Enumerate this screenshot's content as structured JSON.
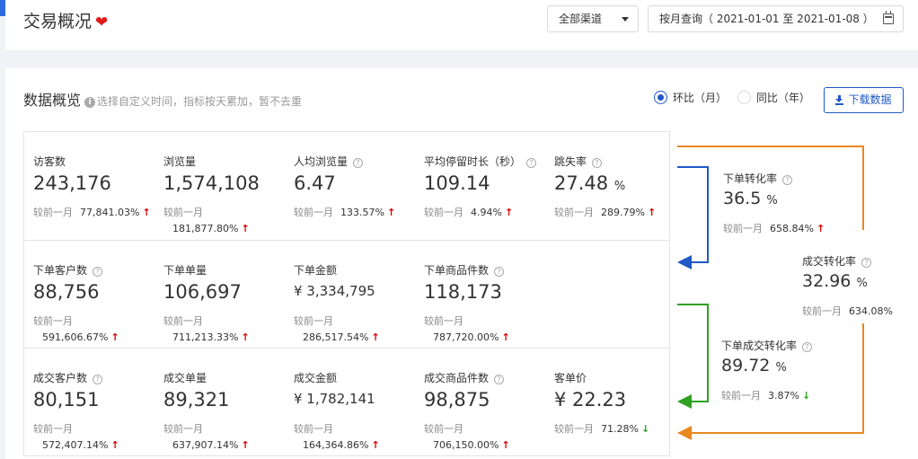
{
  "header": {
    "title": "交易概况",
    "channel": "全部渠道",
    "date_range": "按月查询（ 2021-01-01 至 2021-01-08 ）"
  },
  "overview": {
    "title": "数据概览",
    "hint": "选择自定义时间，指标按天累加，暂不去重",
    "radio_mom": "环比（月）",
    "radio_yoy": "同比（年）",
    "selected_compare": "环比（月）",
    "download_label": "下载数据"
  },
  "compare_label": "较前一月",
  "metrics_rows": [
    [
      {
        "label": "访客数",
        "help": false,
        "value": "243,176",
        "unit": "",
        "change": "77,841.03%",
        "trend": "up",
        "wrap": false
      },
      {
        "label": "浏览量",
        "help": false,
        "value": "1,574,108",
        "unit": "",
        "change": "181,877.80%",
        "trend": "up",
        "wrap": true
      },
      {
        "label": "人均浏览量",
        "help": true,
        "value": "6.47",
        "unit": "",
        "change": "133.57%",
        "trend": "up",
        "wrap": false
      },
      {
        "label": "平均停留时长（秒）",
        "help": true,
        "value": "109.14",
        "unit": "",
        "change": "4.94%",
        "trend": "up",
        "wrap": false
      },
      {
        "label": "跳失率",
        "help": true,
        "value": "27.48",
        "unit": "%",
        "change": "289.79%",
        "trend": "up",
        "wrap": false
      }
    ],
    [
      {
        "label": "下单客户数",
        "help": true,
        "value": "88,756",
        "unit": "",
        "change": "591,606.67%",
        "trend": "up",
        "wrap": true
      },
      {
        "label": "下单单量",
        "help": false,
        "value": "106,697",
        "unit": "",
        "change": "711,213.33%",
        "trend": "up",
        "wrap": true
      },
      {
        "label": "下单金额",
        "help": false,
        "value": "¥ 3,334,795",
        "unit": "",
        "change": "286,517.54%",
        "trend": "up",
        "wrap": true,
        "money": true
      },
      {
        "label": "下单商品件数",
        "help": true,
        "value": "118,173",
        "unit": "",
        "change": "787,720.00%",
        "trend": "up",
        "wrap": true
      }
    ],
    [
      {
        "label": "成交客户数",
        "help": true,
        "value": "80,151",
        "unit": "",
        "change": "572,407.14%",
        "trend": "up",
        "wrap": true
      },
      {
        "label": "成交单量",
        "help": false,
        "value": "89,321",
        "unit": "",
        "change": "637,907.14%",
        "trend": "up",
        "wrap": true
      },
      {
        "label": "成交金额",
        "help": false,
        "value": "¥ 1,782,141",
        "unit": "",
        "change": "164,364.86%",
        "trend": "up",
        "wrap": true,
        "money": true
      },
      {
        "label": "成交商品件数",
        "help": true,
        "value": "98,875",
        "unit": "",
        "change": "706,150.00%",
        "trend": "up",
        "wrap": true
      },
      {
        "label": "客单价",
        "help": false,
        "value": "¥ 22.23",
        "unit": "",
        "change": "71.28%",
        "trend": "down",
        "wrap": false
      }
    ]
  ],
  "conversion": [
    {
      "label": "下单转化率",
      "value": "36.5",
      "unit": "%",
      "change": "658.84%",
      "trend": "up"
    },
    {
      "label": "成交转化率",
      "value": "32.96",
      "unit": "%",
      "change": "634.08%",
      "trend": "up"
    },
    {
      "label": "下单成交转化率",
      "value": "89.72",
      "unit": "%",
      "change": "3.87%",
      "trend": "down"
    }
  ],
  "colors": {
    "primary": "#1f58c7",
    "up": "#d40000",
    "down": "#2ea121",
    "flow_blue": "#1f58c7",
    "flow_green": "#2ea121",
    "flow_orange": "#e8891f",
    "heart": "#e01a1a"
  }
}
